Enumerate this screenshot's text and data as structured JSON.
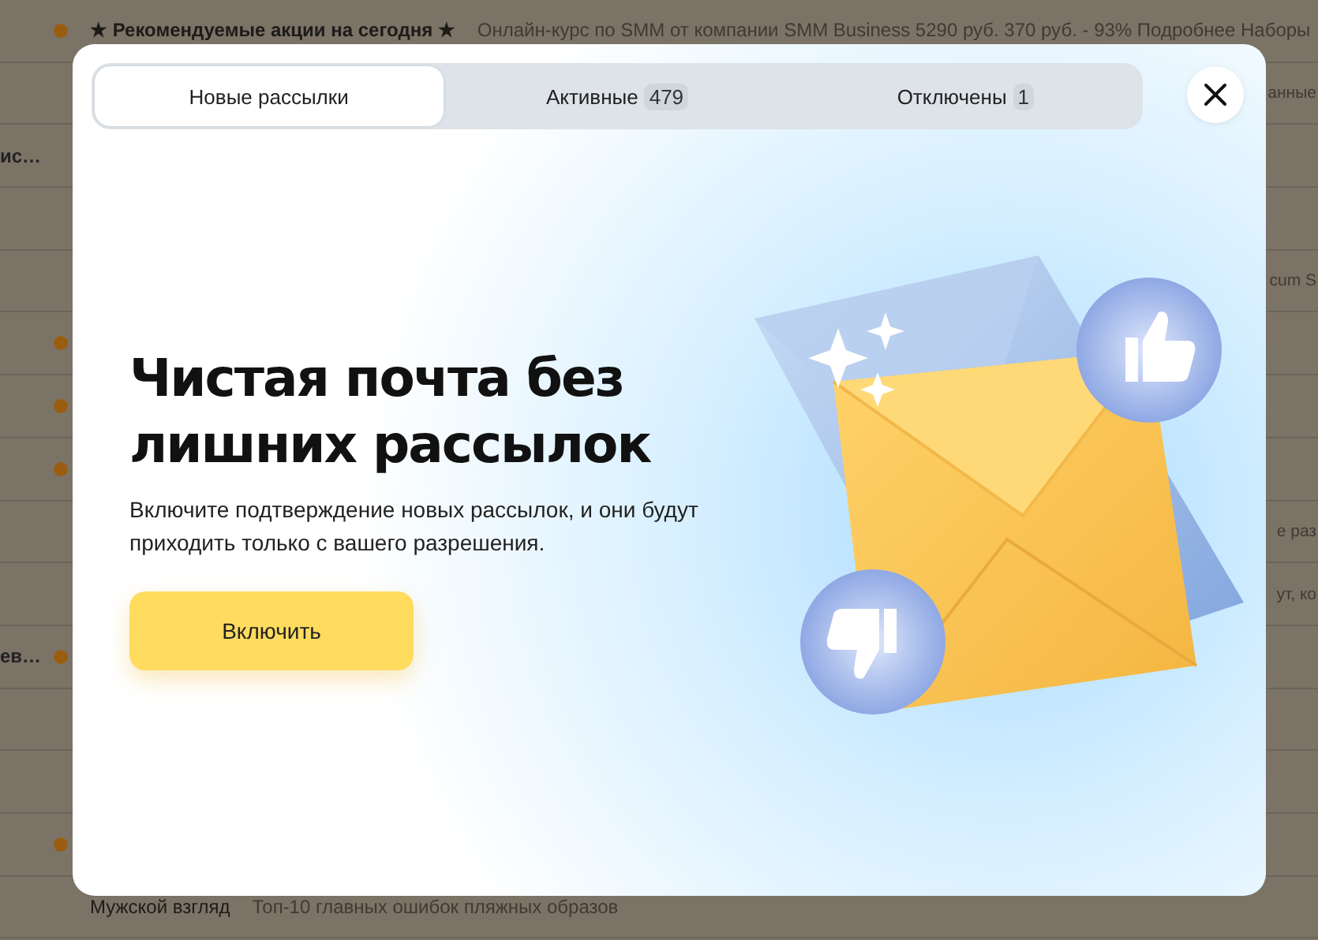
{
  "mail_list": {
    "rows": [
      {
        "unread": true,
        "sender": "★ Рекомендуемые акции на сегодня ★",
        "snippet": "Онлайн-курс по SMM от компании SMM Business 5290 руб. 370 руб. - 93% Подробнее Наборы"
      },
      {
        "unread": false,
        "fragment_right": "анные"
      },
      {
        "unread": false,
        "fragment_left": "ис…"
      },
      {
        "unread": false
      },
      {
        "unread": false,
        "fragment_right": "cum S"
      },
      {
        "unread": true
      },
      {
        "unread": true
      },
      {
        "unread": true
      },
      {
        "unread": false,
        "fragment_right": "е раз"
      },
      {
        "unread": false,
        "fragment_right": "ут, ко"
      },
      {
        "unread": true,
        "fragment_left": "ев…"
      },
      {
        "unread": false
      },
      {
        "unread": false
      },
      {
        "unread": true
      },
      {
        "unread": false,
        "sender": "Мужской взгляд",
        "snippet": "Топ-10 главных ошибок пляжных образов"
      }
    ]
  },
  "dialog": {
    "tabs": [
      {
        "label": "Новые рассылки",
        "selected": true
      },
      {
        "label": "Активные",
        "count": "479",
        "selected": false
      },
      {
        "label": "Отключены",
        "count": "1",
        "selected": false
      }
    ],
    "title": "Чистая почта без лишних рассылок",
    "description": "Включите подтверждение новых рассылок, и они будут приходить только с вашего разрешения.",
    "button": "Включить"
  }
}
